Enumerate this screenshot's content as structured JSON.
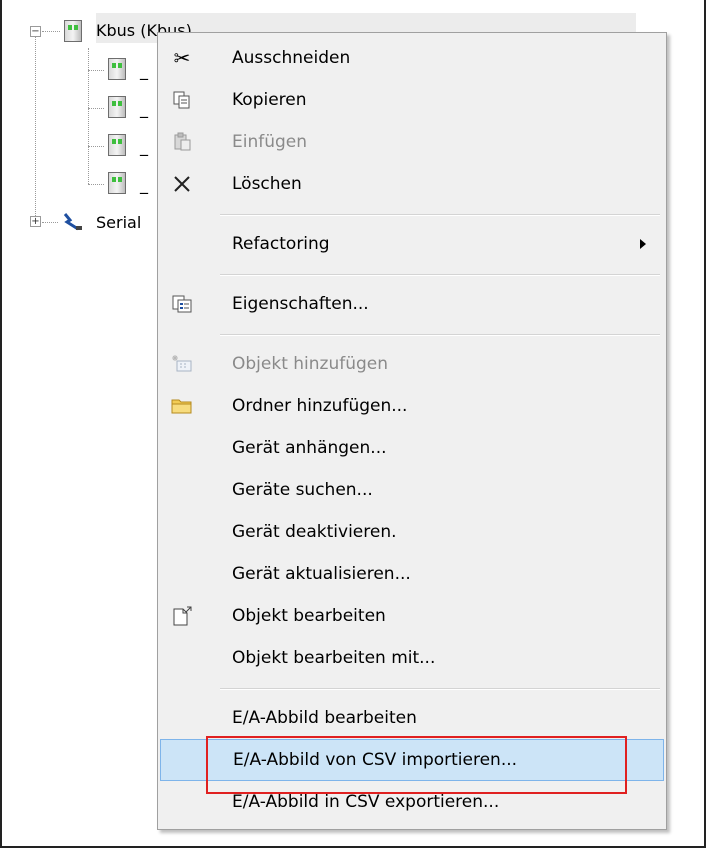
{
  "tree": {
    "root_label": "Kbus (Kbus)",
    "child_labels": [
      "_",
      "_",
      "_",
      "_"
    ],
    "serial_label": "Serial"
  },
  "menu": {
    "cut": "Ausschneiden",
    "copy": "Kopieren",
    "paste": "Einfügen",
    "delete": "Löschen",
    "refactoring": "Refactoring",
    "properties": "Eigenschaften...",
    "add_object": "Objekt hinzufügen",
    "add_folder": "Ordner hinzufügen...",
    "attach_device": "Gerät anhängen...",
    "scan_devices": "Geräte suchen...",
    "disable_device": "Gerät deaktivieren.",
    "update_device": "Gerät aktualisieren...",
    "edit_object": "Objekt bearbeiten",
    "edit_object_with": "Objekt bearbeiten mit...",
    "edit_io_mapping": "E/A-Abbild bearbeiten",
    "import_io_csv": "E/A-Abbild von CSV importieren...",
    "export_io_csv": "E/A-Abbild in CSV exportieren..."
  },
  "colors": {
    "hover_bg": "#cce4f7",
    "hover_border": "#7eb4ea",
    "highlight_box": "#e02020",
    "menu_bg": "#f0f0f0"
  }
}
